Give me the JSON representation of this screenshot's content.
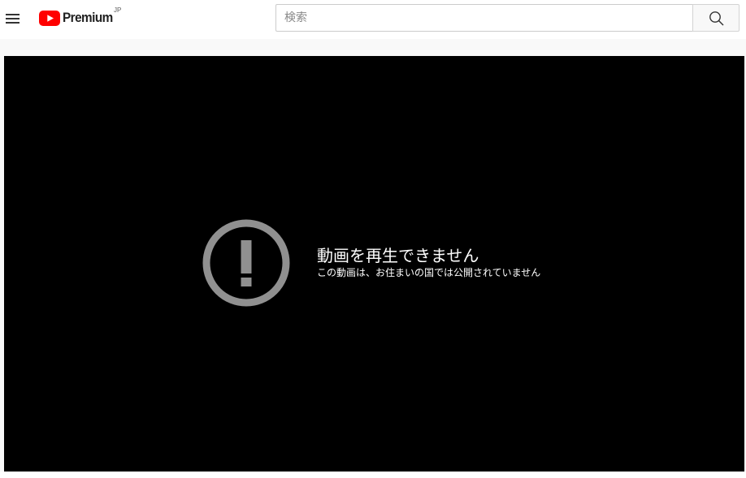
{
  "masthead": {
    "menu_icon": "hamburger-menu-icon",
    "logo": {
      "icon": "youtube-play-logo-icon",
      "text": "Premium",
      "region": "JP",
      "color": "#ff0000"
    },
    "search": {
      "placeholder": "検索",
      "value": "",
      "button_icon": "search-icon"
    }
  },
  "player": {
    "error": {
      "icon": "exclamation-circle-icon",
      "title": "動画を再生できません",
      "subtitle": "この動画は、お住まいの国では公開されていません"
    }
  },
  "colors": {
    "masthead_bg": "#ffffff",
    "page_bg": "#f9f9f9",
    "player_bg": "#000000",
    "brand_red": "#ff0000",
    "error_icon": "#909090",
    "error_text": "#ffffff"
  }
}
